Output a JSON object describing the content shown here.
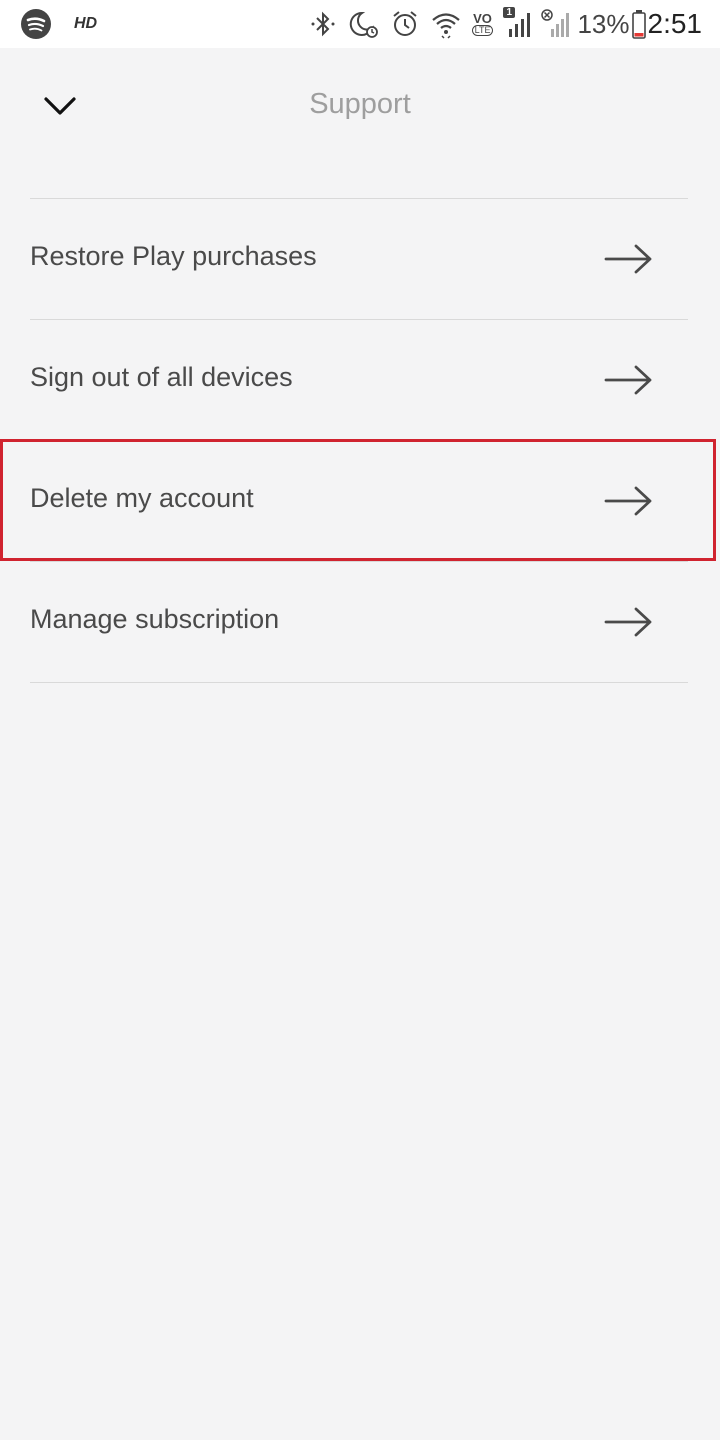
{
  "status_bar": {
    "hd_label": "HD",
    "sim_badge": "1",
    "volte_label": "VO",
    "lte_label": "LTE",
    "battery_percent": "13%",
    "time": "2:51",
    "icons": [
      "spotify-icon",
      "bluetooth-icon",
      "do-not-disturb-icon",
      "alarm-icon",
      "wifi-icon",
      "volte-icon",
      "signal-icon",
      "signal-no-sim-icon",
      "battery-icon"
    ]
  },
  "header": {
    "title": "Support",
    "back_icon": "chevron-down-icon"
  },
  "menu": {
    "items": [
      {
        "label": "Restore Play purchases"
      },
      {
        "label": "Sign out of all devices"
      },
      {
        "label": "Delete my account"
      },
      {
        "label": "Manage subscription"
      }
    ],
    "arrow_icon": "arrow-right-icon",
    "highlight_color": "#d0232f"
  }
}
